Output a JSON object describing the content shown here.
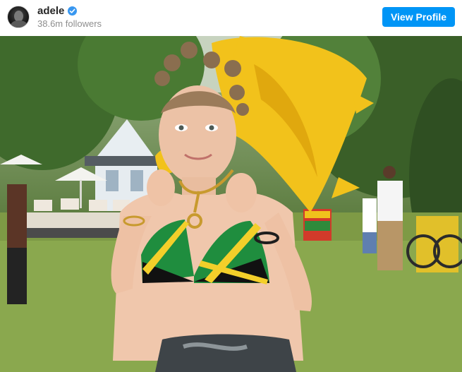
{
  "profile": {
    "username": "adele",
    "followers": "38.6m followers",
    "verified_icon": "verified-badge-icon",
    "avatar_icon": "profile-avatar"
  },
  "actions": {
    "view_profile_label": "View Profile"
  },
  "colors": {
    "button": "#0095f6",
    "verified": "#3897f0",
    "username": "#262626",
    "secondary_text": "#8e8e8e"
  }
}
